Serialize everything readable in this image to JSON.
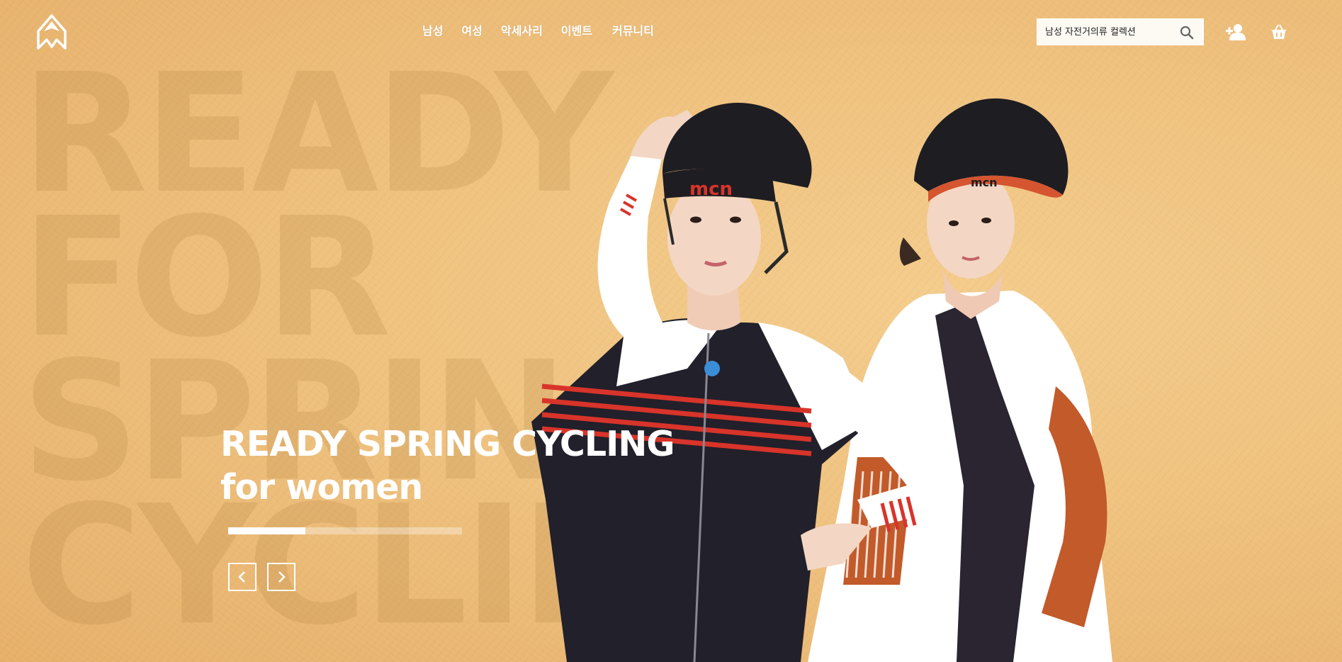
{
  "header": {
    "logo_icon": "mountain-peak-logo-icon",
    "nav": [
      {
        "label": "남성"
      },
      {
        "label": "여성"
      },
      {
        "label": "악세사리"
      },
      {
        "label": "이벤트"
      },
      {
        "label": "커뮤니티"
      }
    ],
    "search": {
      "placeholder": "남성 자전거의류 컬렉션",
      "icon": "search-icon"
    },
    "icons": [
      "user-add-icon",
      "basket-icon"
    ]
  },
  "hero": {
    "background_words": [
      "READY",
      "FOR",
      "SPRING",
      "CYCLING"
    ],
    "title_line1": "READY SPRING CYCLING",
    "title_line2": "for women",
    "slide_progress_fraction": 0.33,
    "prev_icon": "chevron-left-icon",
    "next_icon": "chevron-right-icon",
    "helmet_brand": "mcn"
  },
  "colors": {
    "background": "#efc27f",
    "accent_white": "#ffffff",
    "jersey_red": "#d8342a",
    "jersey_orange": "#c25a2a"
  }
}
